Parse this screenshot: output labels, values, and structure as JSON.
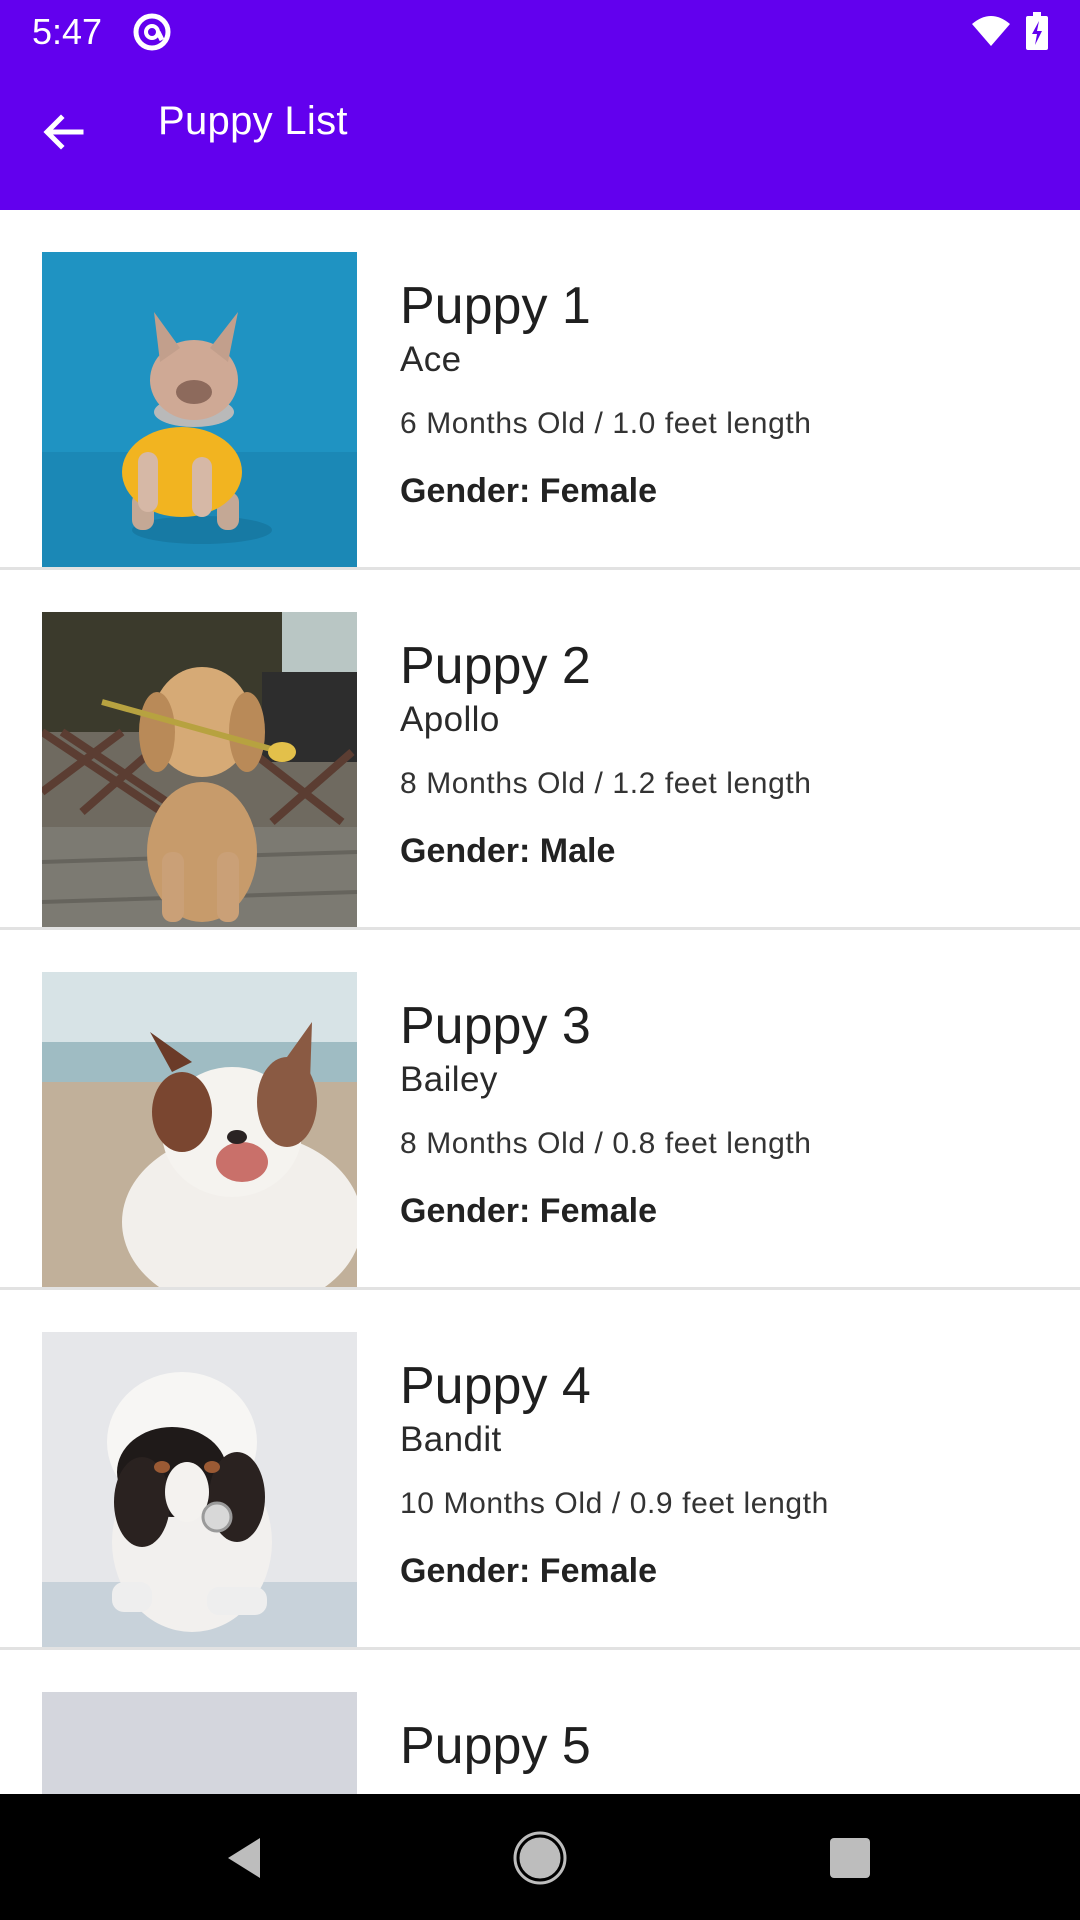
{
  "status_bar": {
    "time": "5:47",
    "app_icon": "at-sign-icon",
    "wifi_icon": "wifi-icon",
    "battery_icon": "battery-charging-icon"
  },
  "toolbar": {
    "title": "Puppy List",
    "back_icon": "arrow-back-icon",
    "background_color": "#6200EE"
  },
  "puppies": [
    {
      "title": "Puppy 1",
      "name": "Ace",
      "details": "6 Months Old / 1.0 feet length",
      "gender": "Gender: Female",
      "image": "french-bulldog-photo"
    },
    {
      "title": "Puppy 2",
      "name": "Apollo",
      "details": "8 Months Old / 1.2 feet length",
      "gender": "Gender: Male",
      "image": "golden-retriever-photo"
    },
    {
      "title": "Puppy 3",
      "name": "Bailey",
      "details": "8 Months Old / 0.8 feet length",
      "gender": "Gender: Female",
      "image": "australian-shepherd-photo"
    },
    {
      "title": "Puppy 4",
      "name": "Bandit",
      "details": "10 Months Old / 0.9 feet length",
      "gender": "Gender: Female",
      "image": "cavalier-spaniel-photo"
    },
    {
      "title": "Puppy 5",
      "name": "",
      "details": "",
      "gender": "",
      "image": "puppy-photo"
    }
  ],
  "nav_bar": {
    "back_icon": "nav-back-icon",
    "home_icon": "nav-home-icon",
    "recents_icon": "nav-recents-icon"
  }
}
